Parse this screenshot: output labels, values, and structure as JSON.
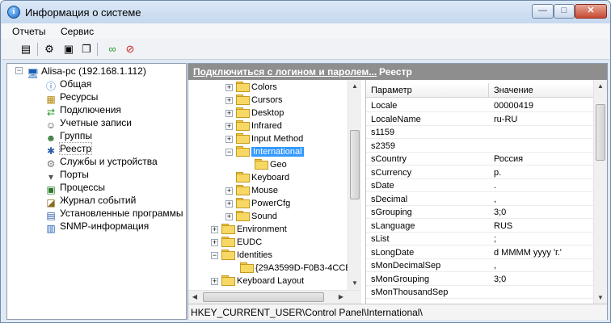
{
  "window": {
    "title": "Информация о системе",
    "minimize": "—",
    "maximize": "□",
    "close": "✕",
    "app_icon": "i"
  },
  "menu": [
    "Отчеты",
    "Сервис"
  ],
  "toolbar": {
    "buttons": [
      "report-icon",
      "network-icon",
      "properties-icon",
      "copy-icon",
      "connect-icon",
      "disconnect-icon"
    ]
  },
  "left_tree": {
    "root": "Alisa-pc (192.168.1.112)",
    "items": [
      {
        "label": "Общая",
        "icon": "info-icon"
      },
      {
        "label": "Ресурсы",
        "icon": "resources-icon"
      },
      {
        "label": "Подключения",
        "icon": "connections-icon"
      },
      {
        "label": "Учетные записи",
        "icon": "accounts-icon"
      },
      {
        "label": "Группы",
        "icon": "groups-icon"
      },
      {
        "label": "Реестр",
        "icon": "registry-icon"
      },
      {
        "label": "Службы и устройства",
        "icon": "services-icon"
      },
      {
        "label": "Порты",
        "icon": "ports-icon"
      },
      {
        "label": "Процессы",
        "icon": "processes-icon"
      },
      {
        "label": "Журнал событий",
        "icon": "eventlog-icon"
      },
      {
        "label": "Установленные программы",
        "icon": "programs-icon"
      },
      {
        "label": "SNMP-информация",
        "icon": "snmp-icon"
      }
    ]
  },
  "header": {
    "link": "Подключиться с логином и паролем...",
    "title": "Реестр"
  },
  "registry_tree": [
    {
      "label": "Colors",
      "exp": "+"
    },
    {
      "label": "Cursors",
      "exp": "+"
    },
    {
      "label": "Desktop",
      "exp": "+"
    },
    {
      "label": "Infrared",
      "exp": "+"
    },
    {
      "label": "Input Method",
      "exp": "+"
    },
    {
      "label": "International",
      "exp": "−"
    },
    {
      "label": "Geo",
      "exp": ""
    },
    {
      "label": "Keyboard",
      "exp": ""
    },
    {
      "label": "Mouse",
      "exp": "+"
    },
    {
      "label": "PowerCfg",
      "exp": "+"
    },
    {
      "label": "Sound",
      "exp": "+"
    },
    {
      "label": "Environment",
      "exp": "+"
    },
    {
      "label": "EUDC",
      "exp": "+"
    },
    {
      "label": "Identities",
      "exp": "−"
    },
    {
      "label": "{29A3599D-F0B3-4CCE",
      "exp": ""
    },
    {
      "label": "Keyboard Layout",
      "exp": "+"
    }
  ],
  "grid": {
    "columns": [
      "Параметр",
      "Значение"
    ],
    "rows": [
      [
        "Locale",
        "00000419"
      ],
      [
        "LocaleName",
        "ru-RU"
      ],
      [
        "s1159",
        ""
      ],
      [
        "s2359",
        ""
      ],
      [
        "sCountry",
        "Россия"
      ],
      [
        "sCurrency",
        "р."
      ],
      [
        "sDate",
        "."
      ],
      [
        "sDecimal",
        ","
      ],
      [
        "sGrouping",
        "3;0"
      ],
      [
        "sLanguage",
        "RUS"
      ],
      [
        "sList",
        ";"
      ],
      [
        "sLongDate",
        "d MMMM yyyy 'г.'"
      ],
      [
        "sMonDecimalSep",
        ","
      ],
      [
        "sMonGrouping",
        "3;0"
      ],
      [
        "sMonThousandSep",
        ""
      ]
    ]
  },
  "status": "HKEY_CURRENT_USER\\Control Panel\\International\\"
}
